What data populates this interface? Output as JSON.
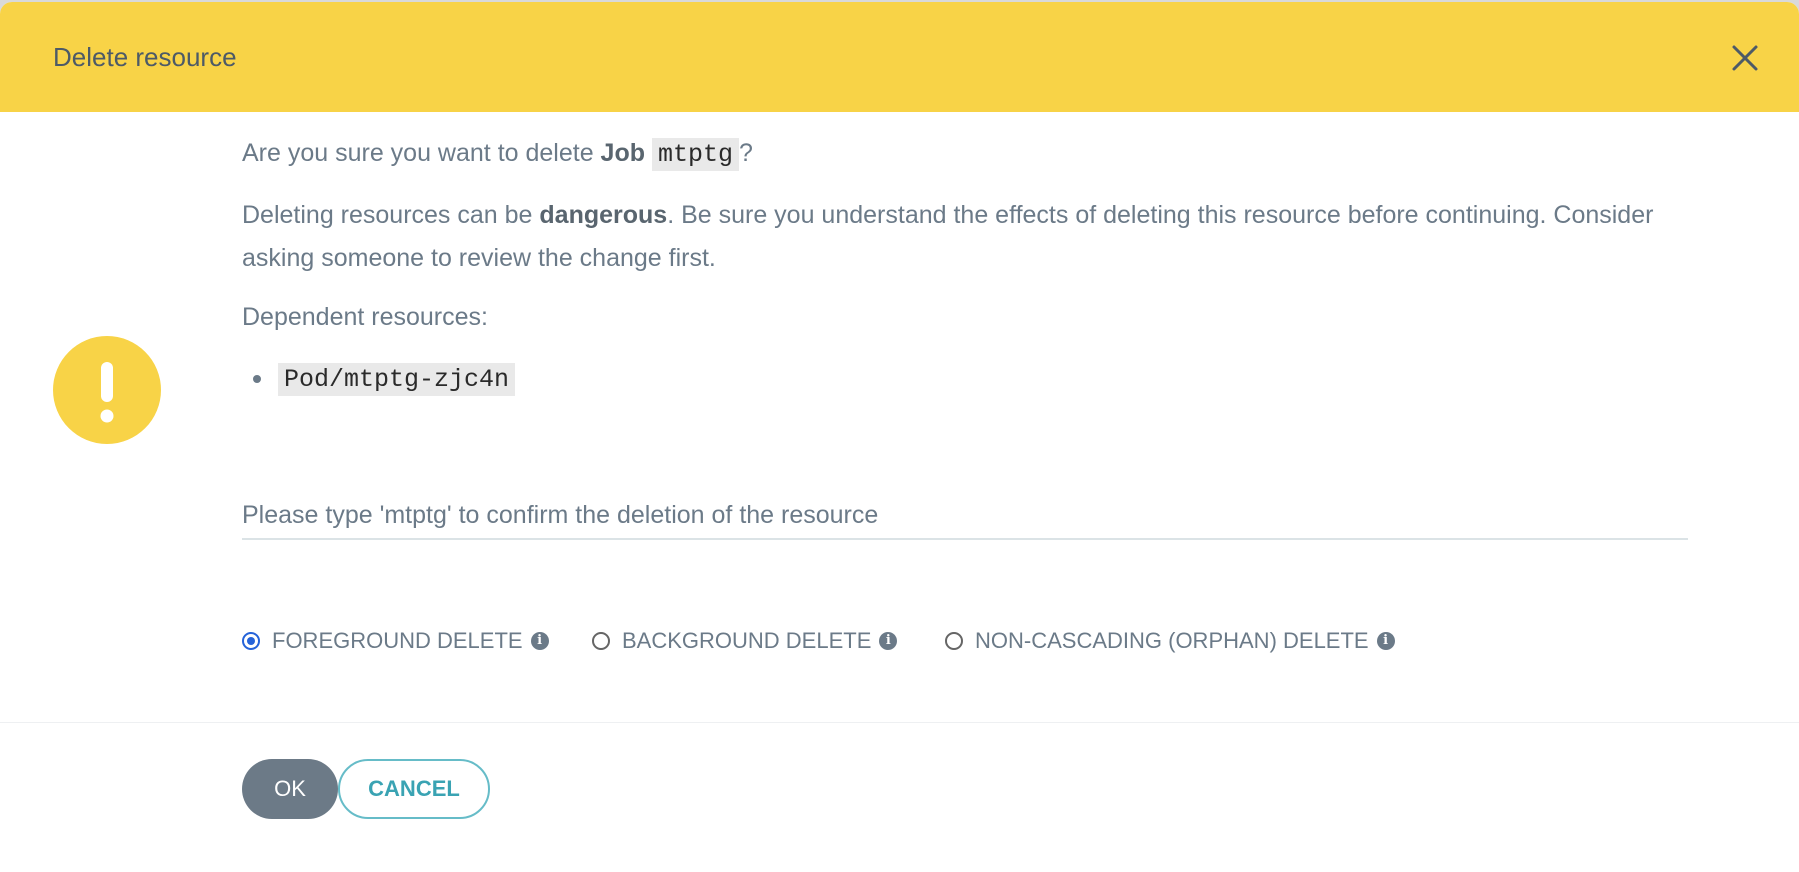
{
  "dialog": {
    "title": "Delete resource"
  },
  "question": {
    "prefix": "Are you sure you want to delete ",
    "kind": "Job",
    "name": "mtptg",
    "suffix": "?"
  },
  "warning": {
    "prefix": "Deleting resources can be ",
    "emphasis": "dangerous",
    "suffix": ". Be sure you understand the effects of deleting this resource before continuing. Consider asking someone to review the change first."
  },
  "dependents": {
    "label": "Dependent resources:",
    "items": [
      "Pod/mtptg-zjc4n"
    ]
  },
  "confirm": {
    "placeholder": "Please type 'mtptg' to confirm the deletion of the resource",
    "value": ""
  },
  "propagation": {
    "selected": "foreground",
    "options": [
      {
        "label": "FOREGROUND DELETE"
      },
      {
        "label": "BACKGROUND DELETE"
      },
      {
        "label": "NON-CASCADING (ORPHAN) DELETE"
      }
    ]
  },
  "buttons": {
    "ok": "OK",
    "cancel": "CANCEL"
  },
  "colors": {
    "header": "#f8d347",
    "warning_icon": "#f8d347",
    "primary_button": "#6c7a87",
    "cancel_accent": "#3aa3b3",
    "radio_checked": "#2563d9"
  },
  "icons": {
    "close": "close-icon",
    "warning": "exclamation-icon",
    "info": "info-icon"
  }
}
